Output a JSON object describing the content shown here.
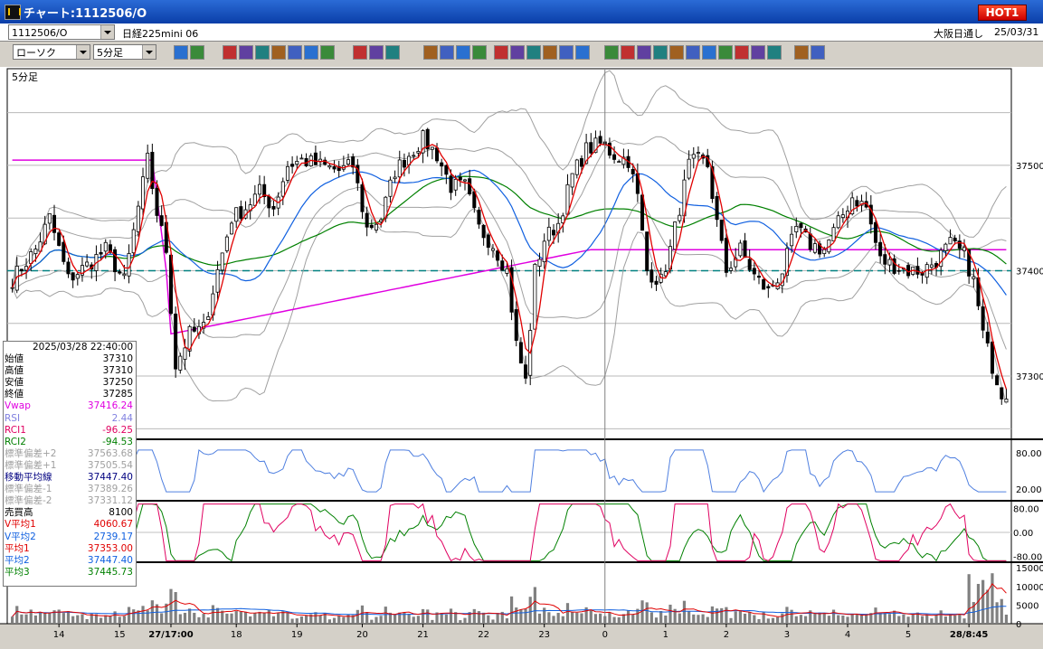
{
  "window": {
    "title": "チャート:1112506/O",
    "hot_label": "HOT1"
  },
  "info": {
    "symbol": "1112506/O",
    "name": "日経225mini 06",
    "session": "大阪日通し",
    "date": "25/03/31"
  },
  "toolbar": {
    "chart_type": "ローソク",
    "interval": "5分足"
  },
  "panel_label": "5分足",
  "colors": {
    "bg": "#ffffff",
    "up": "#ffffff",
    "down": "#000000",
    "vwap": "#e000e0",
    "ma1": "#e00000",
    "ma2": "#1060e0",
    "ma3": "#008000",
    "band": "#a0a0a0",
    "rsi": "#5080e0"
  },
  "data_panel": [
    {
      "label": "",
      "value": "2025/03/28 22:40:00",
      "color": "#000000"
    },
    {
      "label": "始値",
      "value": "37310",
      "color": "#000000"
    },
    {
      "label": "高値",
      "value": "37310",
      "color": "#000000"
    },
    {
      "label": "安値",
      "value": "37250",
      "color": "#000000"
    },
    {
      "label": "終値",
      "value": "37285",
      "color": "#000000"
    },
    {
      "label": "Vwap",
      "value": "37416.24",
      "color": "#e000e0"
    },
    {
      "label": "RSI",
      "value": "2.44",
      "color": "#8080e0"
    },
    {
      "label": "RCI1",
      "value": "-96.25",
      "color": "#e00060"
    },
    {
      "label": "RCI2",
      "value": "-94.53",
      "color": "#008000"
    },
    {
      "label": "標準偏差+2",
      "value": "37563.68",
      "color": "#a0a0a0"
    },
    {
      "label": "標準偏差+1",
      "value": "37505.54",
      "color": "#a0a0a0"
    },
    {
      "label": "移動平均線",
      "value": "37447.40",
      "color": "#000080"
    },
    {
      "label": "標準偏差-1",
      "value": "37389.26",
      "color": "#a0a0a0"
    },
    {
      "label": "標準偏差-2",
      "value": "37331.12",
      "color": "#a0a0a0"
    },
    {
      "label": "売買高",
      "value": "8100",
      "color": "#000000"
    },
    {
      "label": "V平均1",
      "value": "4060.67",
      "color": "#e00000"
    },
    {
      "label": "V平均2",
      "value": "2739.17",
      "color": "#1060e0"
    },
    {
      "label": "平均1",
      "value": "37353.00",
      "color": "#e00000"
    },
    {
      "label": "平均2",
      "value": "37447.40",
      "color": "#1060e0"
    },
    {
      "label": "平均3",
      "value": "37445.73",
      "color": "#008000"
    }
  ],
  "chart_data": {
    "type": "candlestick",
    "price_axis": {
      "ylim": [
        37240,
        37590
      ],
      "ticks": [
        37300,
        37400,
        37500
      ],
      "grid": true
    },
    "rsi_axis": {
      "ylim": [
        0,
        100
      ],
      "ticks": [
        20,
        80
      ],
      "tick_labels": [
        "20.00",
        "80.00"
      ]
    },
    "rci_axis": {
      "ylim": [
        -100,
        100
      ],
      "ticks": [
        -80,
        0,
        80
      ],
      "tick_labels": [
        "-80.00",
        "0.00",
        "80.00"
      ]
    },
    "volume_axis": {
      "ylim": [
        0,
        16000
      ],
      "ticks": [
        0,
        5000,
        10000,
        15000
      ],
      "tick_labels": [
        "0",
        "5000",
        "10000",
        "15000"
      ]
    },
    "x_labels": [
      {
        "label": "14",
        "index": 10
      },
      {
        "label": "15",
        "index": 23
      },
      {
        "label": "27/17:00",
        "index": 34
      },
      {
        "label": "18",
        "index": 48
      },
      {
        "label": "19",
        "index": 61
      },
      {
        "label": "20",
        "index": 75
      },
      {
        "label": "21",
        "index": 88
      },
      {
        "label": "22",
        "index": 101
      },
      {
        "label": "23",
        "index": 114
      },
      {
        "label": "0",
        "index": 127
      },
      {
        "label": "1",
        "index": 140
      },
      {
        "label": "2",
        "index": 153
      },
      {
        "label": "3",
        "index": 166
      },
      {
        "label": "4",
        "index": 179
      },
      {
        "label": "5",
        "index": 192
      },
      {
        "label": "28/8:45",
        "index": 205
      }
    ],
    "cursor_index": 127,
    "reference_level": 37400,
    "close_anchors": [
      [
        0,
        37392
      ],
      [
        5,
        37420
      ],
      [
        8,
        37450
      ],
      [
        12,
        37392
      ],
      [
        16,
        37405
      ],
      [
        20,
        37420
      ],
      [
        24,
        37390
      ],
      [
        27,
        37460
      ],
      [
        29,
        37505
      ],
      [
        31,
        37455
      ],
      [
        33,
        37420
      ],
      [
        35,
        37310
      ],
      [
        38,
        37340
      ],
      [
        41,
        37345
      ],
      [
        44,
        37400
      ],
      [
        47,
        37450
      ],
      [
        50,
        37460
      ],
      [
        53,
        37475
      ],
      [
        56,
        37460
      ],
      [
        59,
        37500
      ],
      [
        62,
        37505
      ],
      [
        66,
        37500
      ],
      [
        70,
        37495
      ],
      [
        73,
        37500
      ],
      [
        76,
        37440
      ],
      [
        79,
        37450
      ],
      [
        82,
        37495
      ],
      [
        85,
        37510
      ],
      [
        88,
        37525
      ],
      [
        91,
        37510
      ],
      [
        94,
        37480
      ],
      [
        97,
        37480
      ],
      [
        100,
        37440
      ],
      [
        103,
        37425
      ],
      [
        106,
        37400
      ],
      [
        108,
        37330
      ],
      [
        110,
        37295
      ],
      [
        112,
        37400
      ],
      [
        114,
        37430
      ],
      [
        117,
        37445
      ],
      [
        120,
        37490
      ],
      [
        123,
        37515
      ],
      [
        126,
        37520
      ],
      [
        129,
        37510
      ],
      [
        132,
        37505
      ],
      [
        134,
        37470
      ],
      [
        136,
        37400
      ],
      [
        139,
        37390
      ],
      [
        141,
        37420
      ],
      [
        143,
        37460
      ],
      [
        145,
        37500
      ],
      [
        147,
        37505
      ],
      [
        149,
        37500
      ],
      [
        151,
        37445
      ],
      [
        153,
        37400
      ],
      [
        156,
        37420
      ],
      [
        159,
        37395
      ],
      [
        162,
        37380
      ],
      [
        165,
        37400
      ],
      [
        168,
        37440
      ],
      [
        171,
        37425
      ],
      [
        174,
        37420
      ],
      [
        177,
        37445
      ],
      [
        180,
        37470
      ],
      [
        183,
        37460
      ],
      [
        186,
        37410
      ],
      [
        189,
        37405
      ],
      [
        192,
        37400
      ],
      [
        195,
        37400
      ],
      [
        198,
        37410
      ],
      [
        201,
        37425
      ],
      [
        204,
        37415
      ],
      [
        206,
        37390
      ],
      [
        208,
        37340
      ],
      [
        210,
        37310
      ],
      [
        212,
        37285
      ]
    ],
    "ma_current": {
      "ma1": 37353.0,
      "ma2": 37447.4,
      "ma3": 37445.73,
      "vwap": 37416.24
    }
  }
}
